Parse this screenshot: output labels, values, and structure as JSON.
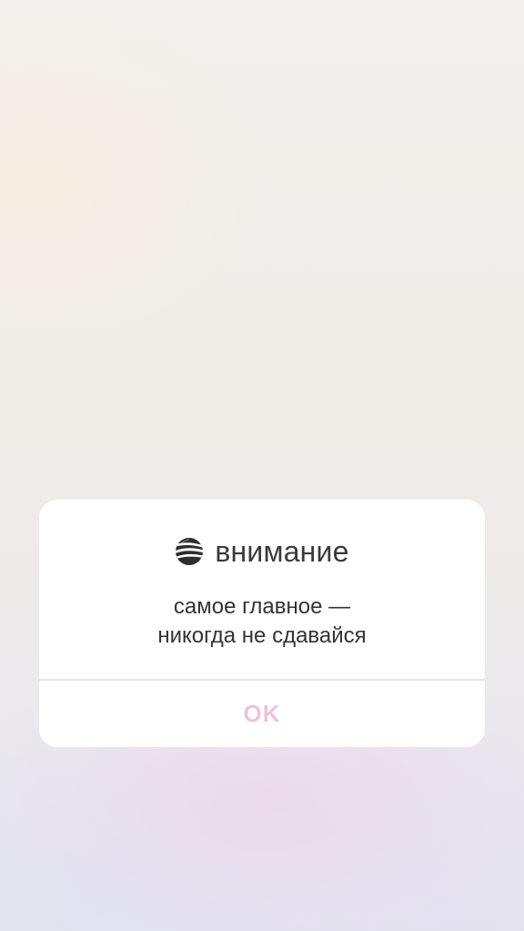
{
  "dialog": {
    "title": "внимание",
    "logo_icon": "striped-globe-icon",
    "message_lines": [
      "самое главное —",
      "никогда не сдавайся"
    ],
    "ok_label": "OK"
  },
  "colors": {
    "dialog_background": "#ffffff",
    "title_text": "#3a3a3c",
    "message_text": "#333336",
    "ok_text": "#efc2d8",
    "divider": "#e4e4e6"
  }
}
